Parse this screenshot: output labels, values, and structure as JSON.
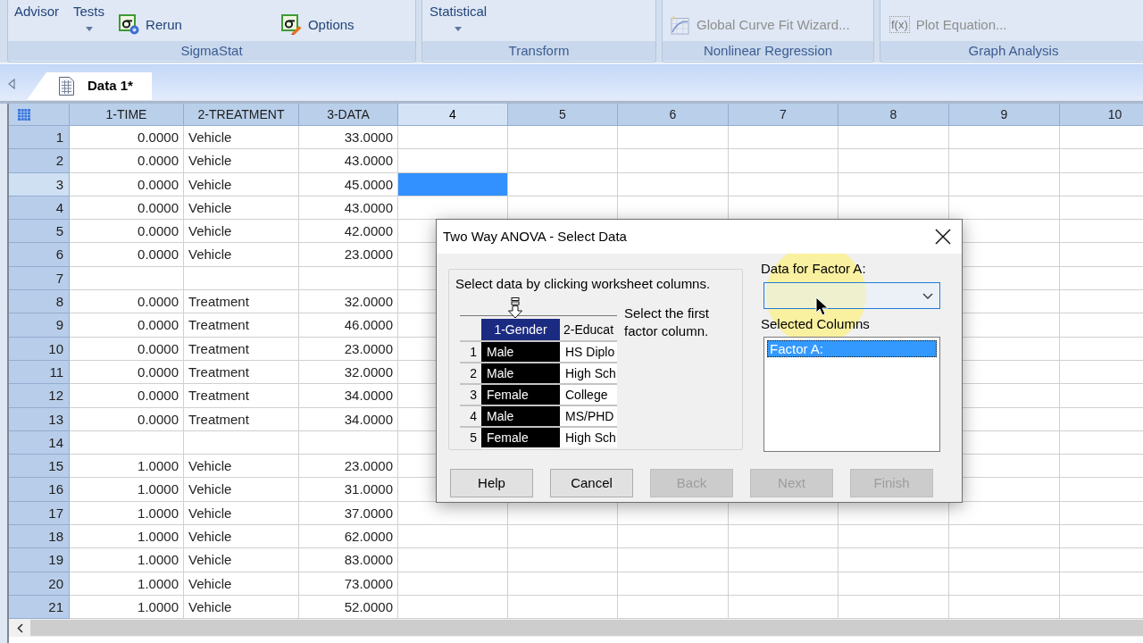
{
  "ribbon": {
    "groups": [
      {
        "label": "SigmaStat",
        "items": [
          {
            "kind": "large",
            "label": "Advisor",
            "disabled": false
          },
          {
            "kind": "dropdown",
            "label": "Tests",
            "disabled": false
          },
          {
            "kind": "small",
            "label": "Rerun",
            "disabled": false
          },
          {
            "kind": "small",
            "label": "Options",
            "disabled": false
          }
        ]
      },
      {
        "label": "Transform",
        "items": [
          {
            "kind": "dropdown",
            "label": "Statistical",
            "disabled": false
          }
        ]
      },
      {
        "label": "Nonlinear Regression",
        "items": [
          {
            "kind": "small",
            "label": "Global Curve Fit Wizard...",
            "disabled": true
          }
        ]
      },
      {
        "label": "Graph Analysis",
        "items": [
          {
            "kind": "small",
            "label": "Plot Equation...",
            "disabled": true,
            "icon_text": "f(x)"
          }
        ]
      }
    ]
  },
  "document_tabs": [
    {
      "label": "Data 1*",
      "selected": true
    }
  ],
  "worksheet": {
    "columns": [
      {
        "label": "1-TIME",
        "selected": false
      },
      {
        "label": "2-TREATMENT",
        "selected": false
      },
      {
        "label": "3-DATA",
        "selected": false
      },
      {
        "label": "4",
        "selected": true
      },
      {
        "label": "5",
        "selected": false
      },
      {
        "label": "6",
        "selected": false
      },
      {
        "label": "7",
        "selected": false
      },
      {
        "label": "8",
        "selected": false
      },
      {
        "label": "9",
        "selected": false
      },
      {
        "label": "10",
        "selected": false
      }
    ],
    "rows": [
      {
        "header": "1",
        "selected": false,
        "cells": [
          "0.0000",
          "Vehicle",
          "33.0000"
        ]
      },
      {
        "header": "2",
        "selected": false,
        "cells": [
          "0.0000",
          "Vehicle",
          "43.0000"
        ]
      },
      {
        "header": "3",
        "selected": true,
        "cells": [
          "0.0000",
          "Vehicle",
          "45.0000"
        ]
      },
      {
        "header": "4",
        "selected": false,
        "cells": [
          "0.0000",
          "Vehicle",
          "43.0000"
        ]
      },
      {
        "header": "5",
        "selected": false,
        "cells": [
          "0.0000",
          "Vehicle",
          "42.0000"
        ]
      },
      {
        "header": "6",
        "selected": false,
        "cells": [
          "0.0000",
          "Vehicle",
          "23.0000"
        ]
      },
      {
        "header": "7",
        "selected": false
      },
      {
        "header": "8",
        "selected": false,
        "cells": [
          "0.0000",
          "Treatment",
          "32.0000"
        ]
      },
      {
        "header": "9",
        "selected": false,
        "cells": [
          "0.0000",
          "Treatment",
          "46.0000"
        ]
      },
      {
        "header": "10",
        "selected": false,
        "cells": [
          "0.0000",
          "Treatment",
          "23.0000"
        ]
      },
      {
        "header": "11",
        "selected": false,
        "cells": [
          "0.0000",
          "Treatment",
          "32.0000"
        ]
      },
      {
        "header": "12",
        "selected": false,
        "cells": [
          "0.0000",
          "Treatment",
          "34.0000"
        ]
      },
      {
        "header": "13",
        "selected": false,
        "cells": [
          "0.0000",
          "Treatment",
          "34.0000"
        ]
      },
      {
        "header": "14",
        "selected": false
      },
      {
        "header": "15",
        "selected": false,
        "cells": [
          "1.0000",
          "Vehicle",
          "23.0000"
        ]
      },
      {
        "header": "16",
        "selected": false,
        "cells": [
          "1.0000",
          "Vehicle",
          "31.0000"
        ]
      },
      {
        "header": "17",
        "selected": false,
        "cells": [
          "1.0000",
          "Vehicle",
          "37.0000"
        ]
      },
      {
        "header": "18",
        "selected": false,
        "cells": [
          "1.0000",
          "Vehicle",
          "62.0000"
        ]
      },
      {
        "header": "19",
        "selected": false,
        "cells": [
          "1.0000",
          "Vehicle",
          "83.0000"
        ]
      },
      {
        "header": "20",
        "selected": false,
        "cells": [
          "1.0000",
          "Vehicle",
          "73.0000"
        ]
      },
      {
        "header": "21",
        "selected": false,
        "cells": [
          "1.0000",
          "Vehicle",
          "52.0000"
        ]
      }
    ]
  },
  "dialog": {
    "title": "Two Way ANOVA - Select Data",
    "instruction": "Select data by clicking worksheet columns.",
    "example_sheet": {
      "columns": [
        {
          "label": "1-Gender",
          "selected": true
        },
        {
          "label": "2-Educat",
          "selected": false
        }
      ],
      "rows": [
        {
          "header": "1",
          "cells": [
            "Male",
            "HS Diplo"
          ]
        },
        {
          "header": "2",
          "cells": [
            "Male",
            "High Sch"
          ]
        },
        {
          "header": "3",
          "cells": [
            "Female",
            "College"
          ]
        },
        {
          "header": "4",
          "cells": [
            "Male",
            "MS/PHD"
          ]
        },
        {
          "header": "5",
          "cells": [
            "Female",
            "High Sch"
          ]
        }
      ]
    },
    "hint": "Select the first factor column.",
    "factor_field": {
      "label": "Data for Factor A:",
      "focused": true
    },
    "selected_columns": {
      "label": "Selected Columns",
      "items": [
        {
          "label": "Factor A:",
          "selected": true
        }
      ]
    },
    "buttons": [
      {
        "label": "Help",
        "disabled": false
      },
      {
        "label": "Cancel",
        "disabled": false
      },
      {
        "label": "Back",
        "disabled": true
      },
      {
        "label": "Next",
        "disabled": true
      },
      {
        "label": "Finish",
        "disabled": true
      }
    ]
  }
}
